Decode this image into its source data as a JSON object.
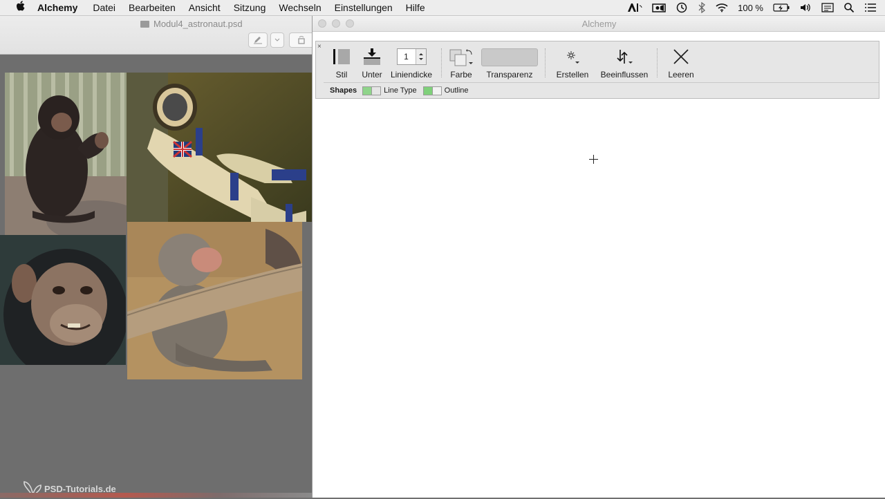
{
  "menubar": {
    "app_name": "Alchemy",
    "items": [
      "Datei",
      "Bearbeiten",
      "Ansicht",
      "Sitzung",
      "Wechseln",
      "Einstellungen",
      "Hilfe"
    ],
    "status": {
      "battery_text": "100 %",
      "icons": [
        "adobe-icon",
        "screencast-icon",
        "time-machine-icon",
        "bluetooth-icon",
        "wifi-icon",
        "battery-icon",
        "volume-icon",
        "calendar-icon",
        "search-icon",
        "list-icon"
      ]
    }
  },
  "document": {
    "title": "Modul4_astronaut.psd",
    "watermark": "PSD-Tutorials.de"
  },
  "alchemy": {
    "title": "Alchemy",
    "toolbar": {
      "style_label": "Stil",
      "under_label": "Unter",
      "line_width_label": "Liniendicke",
      "line_width_value": "1",
      "color_label": "Farbe",
      "transparency_label": "Transparenz",
      "create_label": "Erstellen",
      "affect_label": "Beeinflussen",
      "clear_label": "Leeren"
    },
    "shapes_bar": {
      "label": "Shapes",
      "line_type_label": "Line Type",
      "outline_label": "Outline"
    }
  },
  "colors": {
    "menubar_bg": "#ededed",
    "canvas_bg": "#6e6e6e",
    "swatch_green": "#7fd07a"
  }
}
